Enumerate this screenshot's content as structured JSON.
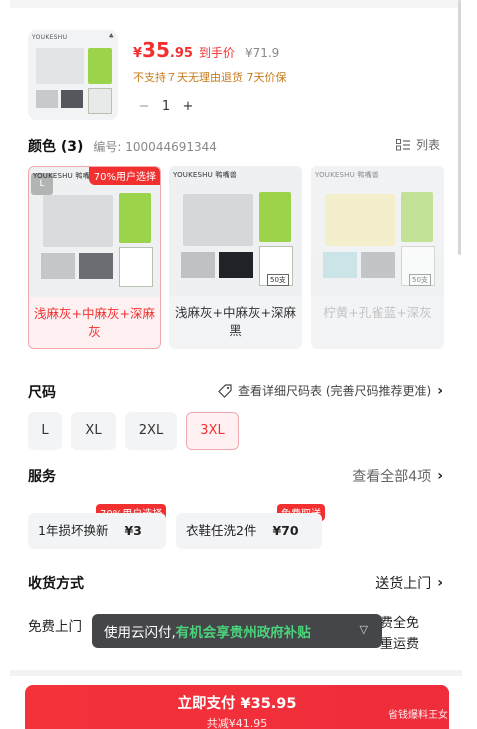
{
  "product": {
    "thumb_brand": "YOUKESHU",
    "currency": "¥",
    "price_int": "35",
    "price_dec": ".95",
    "price_label": "到手价",
    "original_price": "¥71.9",
    "policy": "不支持７天无理由退货  7天价保",
    "quantity": "1",
    "minus": "−",
    "plus": "+"
  },
  "color": {
    "title": "颜色 (3)",
    "sku": "编号: 100044691344",
    "list_label": "列表",
    "options": [
      {
        "label": "浅麻灰+中麻灰+深麻灰",
        "badge": "70%用户选择",
        "brand": "YOUKESHU 鸭嘴兽",
        "state": "selected"
      },
      {
        "label": "浅麻灰+中麻灰+深麻黑",
        "brand": "YOUKESHU 鸭嘴兽",
        "count": "50支",
        "state": "normal"
      },
      {
        "label": "柠黄+孔雀蓝+深灰",
        "brand": "YOUKESHU 鸭嘴兽",
        "count": "50支",
        "state": "disabled"
      }
    ]
  },
  "size": {
    "title": "尺码",
    "guide": "查看详细尺码表 (完善尺码推荐更准)",
    "options": [
      "L",
      "XL",
      "2XL",
      "3XL"
    ],
    "selected": "3XL"
  },
  "service": {
    "title": "服务",
    "view_all": "查看全部4项",
    "items": [
      {
        "name": "1年损坏换新",
        "price": "¥3",
        "badge": "70%用户选择"
      },
      {
        "name": "衣鞋任洗2件",
        "price": "¥70",
        "badge": "免费取送"
      }
    ]
  },
  "delivery": {
    "title": "收货方式",
    "value": "送货上门",
    "free_pickup": "免费上门",
    "right_line1": "费全免",
    "right_line2": "重运费"
  },
  "toast": {
    "prefix": "使用云闪付,",
    "highlight": "有机会享贵州政府补贴"
  },
  "pay": {
    "main": "立即支付 ¥35.95",
    "sub": "共减¥41.95"
  },
  "watermark": "省钱爆料王女",
  "colors": {
    "accent": "#f23030",
    "policy": "#c77a1a",
    "toast_highlight": "#4cd27a"
  }
}
